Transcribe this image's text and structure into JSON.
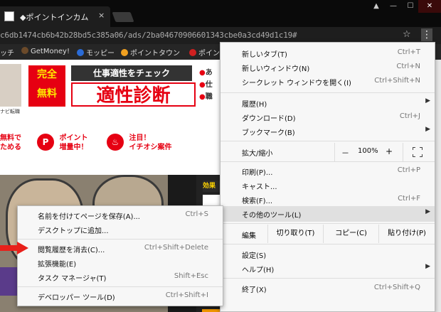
{
  "window": {
    "tab_title": "◆ポイントインカム",
    "tab_close": "×",
    "controls": {
      "user": "▲",
      "minimize": "—",
      "maximize": "☐",
      "close": "✕"
    }
  },
  "address": {
    "url": "c6db1474cb6b42b28bd5c385a06/ads/2ba04670906601343cbe0a3cd49d1c19#",
    "star": "☆",
    "menu": "⋮"
  },
  "bookmarks": [
    {
      "label": "ッチ",
      "color": "#262626"
    },
    {
      "label": "GetMoney!",
      "color": "#6b4a2a"
    },
    {
      "label": "モッピー",
      "color": "#2a6bd6"
    },
    {
      "label": "ポイントタウン",
      "color": "#f0a020"
    },
    {
      "label": "ポイン",
      "color": "#d02020"
    }
  ],
  "page": {
    "ad_avatar_caption": "ナビ転職",
    "ad_badge": [
      "完全",
      "無料"
    ],
    "ad_title": "仕事適性をチェック",
    "ad_main": "適性診断",
    "ad_bullets": [
      "あ",
      "仕",
      "職"
    ],
    "features": [
      {
        "icon": "",
        "line1": "無料で",
        "line2": "ためる"
      },
      {
        "icon": "P",
        "line1": "ポイント",
        "line2": "増量中！"
      },
      {
        "icon": "♨",
        "line1": "注目！",
        "line2": "イチオシ案件"
      }
    ],
    "side_tag": "効果"
  },
  "main_menu": {
    "items": [
      {
        "label": "新しいタブ(T)",
        "shortcut": "Ctrl+T"
      },
      {
        "label": "新しいウィンドウ(N)",
        "shortcut": "Ctrl+N"
      },
      {
        "label": "シークレット ウィンドウを開く(I)",
        "shortcut": "Ctrl+Shift+N"
      },
      {
        "label": "履歴(H)",
        "arrow": "▶"
      },
      {
        "label": "ダウンロード(D)",
        "shortcut": "Ctrl+J"
      },
      {
        "label": "ブックマーク(B)",
        "arrow": "▶"
      }
    ],
    "zoom": {
      "label": "拡大/縮小",
      "minus": "－",
      "value": "100%",
      "plus": "+"
    },
    "items2": [
      {
        "label": "印刷(P)...",
        "shortcut": "Ctrl+P"
      },
      {
        "label": "キャスト...",
        "shortcut": ""
      },
      {
        "label": "検索(F)...",
        "shortcut": "Ctrl+F"
      },
      {
        "label": "その他のツール(L)",
        "arrow": "▶"
      }
    ],
    "edit": {
      "label": "編集",
      "cut": "切り取り(T)",
      "copy": "コピー(C)",
      "paste": "貼り付け(P)"
    },
    "items3": [
      {
        "label": "設定(S)",
        "arrow": ""
      },
      {
        "label": "ヘルプ(H)",
        "arrow": "▶"
      }
    ],
    "exit": {
      "label": "終了(X)",
      "shortcut": "Ctrl+Shift+Q"
    }
  },
  "sub_menu": {
    "items": [
      {
        "label": "名前を付けてページを保存(A)...",
        "shortcut": "Ctrl+S"
      },
      {
        "label": "デスクトップに追加...",
        "shortcut": ""
      },
      {
        "label": "閲覧履歴を消去(C)...",
        "shortcut": "Ctrl+Shift+Delete"
      },
      {
        "label": "拡張機能(E)",
        "shortcut": ""
      },
      {
        "label": "タスク マネージャ(T)",
        "shortcut": "Shift+Esc"
      },
      {
        "label": "デベロッパー ツール(D)",
        "shortcut": "Ctrl+Shift+I"
      }
    ]
  },
  "colors": {
    "accent_red": "#e60012",
    "arrow_red": "#e8201a",
    "menu_bg": "#f7f7f7",
    "highlight": "#e0e0e0"
  }
}
